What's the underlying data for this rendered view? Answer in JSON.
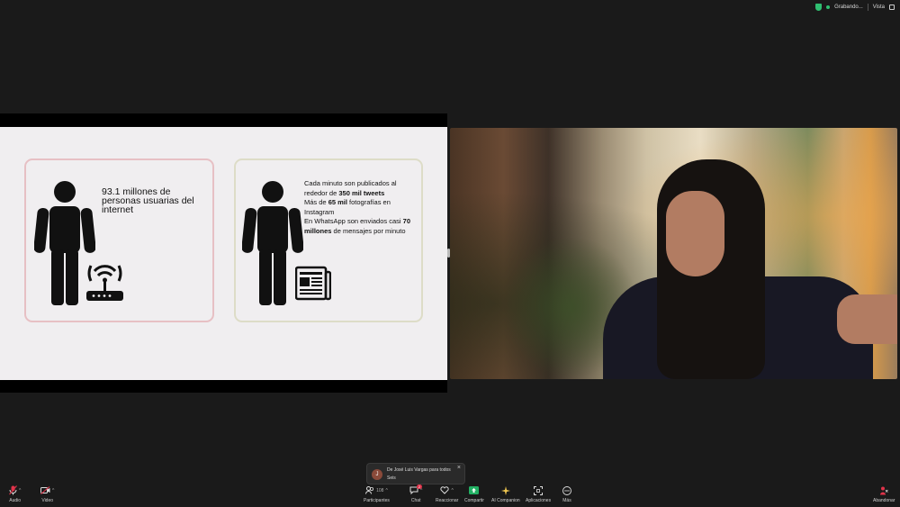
{
  "status": {
    "recording_label": "Grabando...",
    "view_label": "Vista"
  },
  "slide": {
    "left_card": {
      "stat": "93.1 millones de personas usuarias del internet",
      "icon_person": "person-icon",
      "icon_device": "wifi-router-icon"
    },
    "right_card": {
      "line1_pre": "Cada minuto son publicados al rededor de ",
      "line1_bold": "350 mil tweets",
      "line2_pre": "Más de ",
      "line2_bold": "65 mil",
      "line2_post": " fotografías en Instagram",
      "line3_pre": "En WhatsApp son enviados casi ",
      "line3_bold": "70 millones",
      "line3_post": " de mensajes por minuto",
      "icon_person": "person-icon",
      "icon_device": "newspaper-icon"
    },
    "colors": {
      "left_border": "#e7c0c4",
      "right_border": "#dddcc7",
      "background": "#f0eef0"
    }
  },
  "chat_toast": {
    "avatar_initial": "J",
    "from": "De José Luis Vargas para todos",
    "message": "Seis"
  },
  "toolbar": {
    "audio": "Audio",
    "video": "Video",
    "participants": "Participantes",
    "participants_count": "108",
    "chat": "Chat",
    "chat_badge": "2",
    "react": "Reaccionar",
    "share": "Compartir",
    "ai": "AI Companion",
    "apps": "Aplicaciones",
    "more": "Más",
    "leave": "Abandonar"
  }
}
